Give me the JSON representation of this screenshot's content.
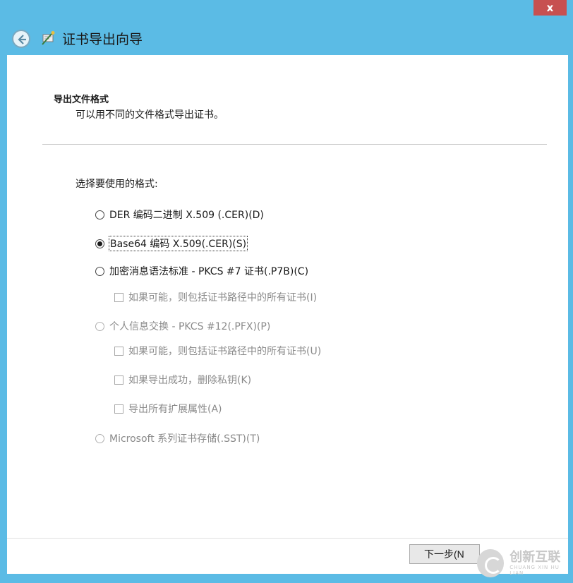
{
  "window": {
    "close_glyph": "x",
    "title": "证书导出向导"
  },
  "section": {
    "heading": "导出文件格式",
    "description": "可以用不同的文件格式导出证书。"
  },
  "prompt": "选择要使用的格式:",
  "options": [
    {
      "label": "DER 编码二进制 X.509 (.CER)(D)",
      "type": "radio",
      "checked": false,
      "disabled": false
    },
    {
      "label": "Base64 编码 X.509(.CER)(S)",
      "type": "radio",
      "checked": true,
      "disabled": false
    },
    {
      "label": "加密消息语法标准 - PKCS #7 证书(.P7B)(C)",
      "type": "radio",
      "checked": false,
      "disabled": false
    },
    {
      "label": "如果可能，则包括证书路径中的所有证书(I)",
      "type": "checkbox",
      "checked": false,
      "disabled": true
    },
    {
      "label": "个人信息交换 - PKCS #12(.PFX)(P)",
      "type": "radio",
      "checked": false,
      "disabled": true
    },
    {
      "label": "如果可能，则包括证书路径中的所有证书(U)",
      "type": "checkbox",
      "checked": false,
      "disabled": true
    },
    {
      "label": "如果导出成功，删除私钥(K)",
      "type": "checkbox",
      "checked": false,
      "disabled": true
    },
    {
      "label": "导出所有扩展属性(A)",
      "type": "checkbox",
      "checked": false,
      "disabled": true
    },
    {
      "label": "Microsoft 系列证书存储(.SST)(T)",
      "type": "radio",
      "checked": false,
      "disabled": true
    }
  ],
  "buttons": {
    "next": "下一步(N"
  },
  "watermark": {
    "main": "创新互联",
    "sub": "CHUANG XIN HU LIAN"
  },
  "icons": {
    "back": "back-arrow-icon",
    "wizard": "certificate-wizard-icon",
    "close": "close-icon"
  },
  "colors": {
    "frame": "#5bbbe5",
    "close": "#c75050",
    "disabled_text": "#8a8a8a"
  }
}
